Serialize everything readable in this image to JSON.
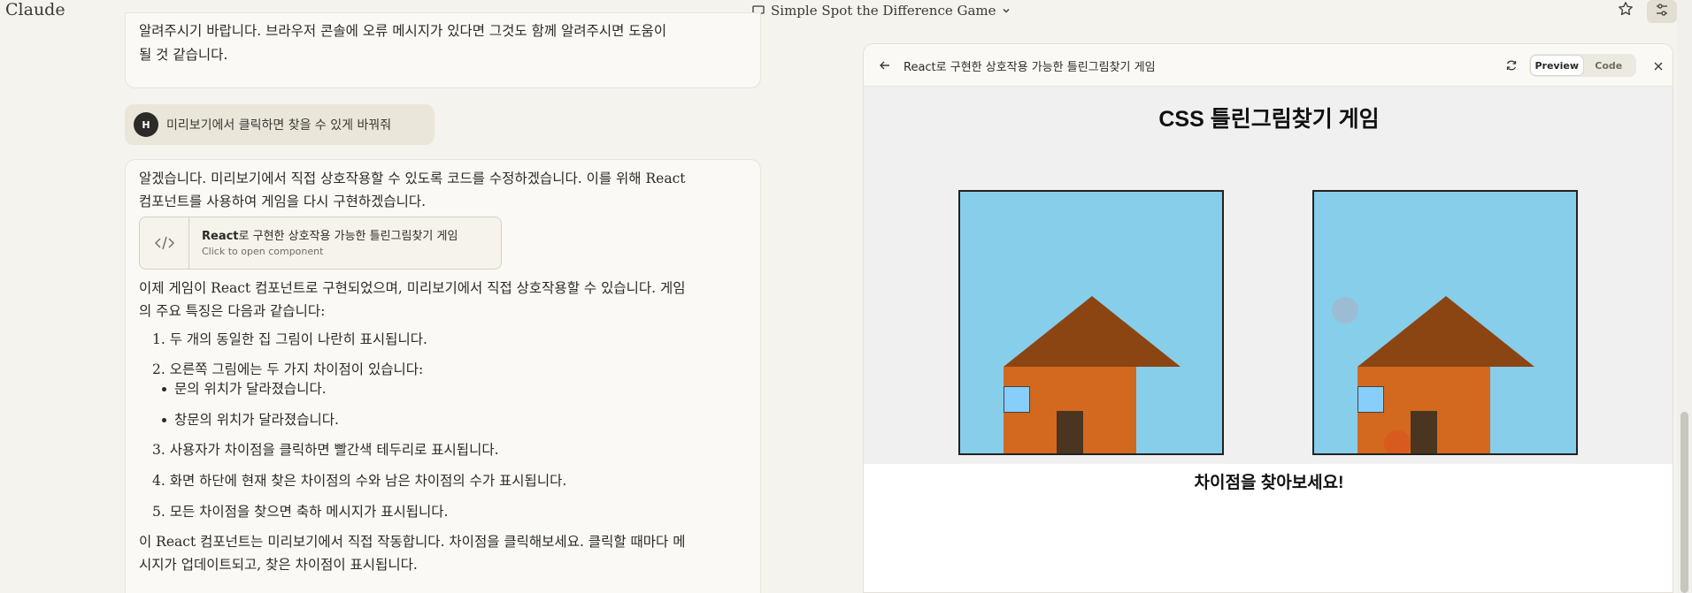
{
  "app": {
    "brand": "Claude",
    "conversation_title": "Simple Spot the Difference Game"
  },
  "chat": {
    "prev_assistant": {
      "line1": "알려주시기 바랍니다. 브라우저 콘솔에 오류 메시지가 있다면 그것도 함께 알려주시면 도움이",
      "line2": "될 것 같습니다."
    },
    "user_message": {
      "avatar_initial": "H",
      "text": "미리보기에서 클릭하면 찾을 수 있게 바꿔줘"
    },
    "assistant": {
      "intro_line1": "알겠습니다. 미리보기에서 직접 상호작용할 수 있도록 코드를 수정하겠습니다. 이를 위해 React",
      "intro_line2": "컴포넌트를 사용하여 게임을 다시 구현하겠습니다.",
      "artifact": {
        "title_bold": "React",
        "title_rest": "로 구현한 상호작용 가능한 틀린그림찾기 게임",
        "subtitle": "Click to open component"
      },
      "para2_line1": "이제 게임이 React 컴포넌트로 구현되었으며, 미리보기에서 직접 상호작용할 수 있습니다. 게임",
      "para2_line2": "의 주요 특징은 다음과 같습니다:",
      "list": [
        "1. 두 개의 동일한 집 그림이 나란히 표시됩니다.",
        "2. 오른쪽 그림에는 두 가지 차이점이 있습니다:",
        "3. 사용자가 차이점을 클릭하면 빨간색 테두리로 표시됩니다.",
        "4. 화면 하단에 현재 찾은 차이점의 수와 남은 차이점의 수가 표시됩니다.",
        "5. 모든 차이점을 찾으면 축하 메시지가 표시됩니다."
      ],
      "sublist": [
        "문의 위치가 달라졌습니다.",
        "창문의 위치가 달라졌습니다."
      ],
      "para3_line1": "이 React 컴포넌트는 미리보기에서 직접 작동합니다. 차이점을 클릭해보세요. 클릭할 때마다 메",
      "para3_line2": "시지가 업데이트되고, 찾은 차이점이 표시됩니다."
    }
  },
  "panel": {
    "title": "React로 구현한 상호작용 가능한 틀린그림찾기 게임",
    "toggle_preview": "Preview",
    "toggle_code": "Code",
    "game_title": "CSS 틀린그림찾기 게임",
    "caption": "차이점을 찾아보세요!"
  },
  "colors": {
    "sky": "#87ceeb",
    "roof": "#8b4513",
    "wall": "#d2691e",
    "door": "#4a3520",
    "window": "#87cefa",
    "preview_bg": "#f0f0f0"
  },
  "icons": [
    "chat-bubble-icon",
    "chevron-down-icon",
    "star-icon",
    "settings-sliders-icon",
    "code-brackets-icon",
    "arrow-left-icon",
    "refresh-icon",
    "close-icon"
  ]
}
